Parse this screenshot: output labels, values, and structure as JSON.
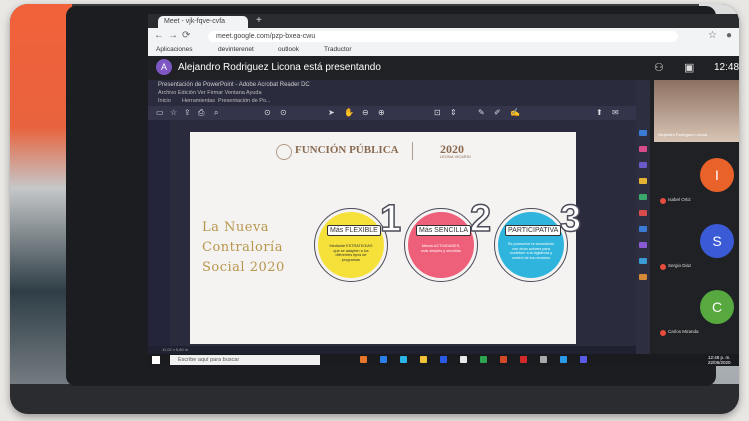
{
  "browser": {
    "tab_label": "Meet - vjk-fqve-cvfa",
    "url": "meet.google.com/pzp-bxea-cwu",
    "bookmarks": [
      "Aplicaciones",
      "devinterenet",
      "outlook",
      "Traductor"
    ]
  },
  "meet": {
    "avatar_letter": "A",
    "presenting_text": "Alejandro Rodriguez Licona está presentando",
    "time": "12:48"
  },
  "app": {
    "title": "Presentación de PowerPoint - Adobe Acrobat Reader DC",
    "menu": "Archivo  Edición  Ver  Firmar  Ventana  Ayuda",
    "tabs": [
      "Inicio",
      "Herramientas",
      "Presentación de Po..."
    ],
    "status": "11,02 x 5,80 in"
  },
  "slide": {
    "logo_left": "FUNCIÓN PÚBLICA",
    "logo_right": "2020",
    "logo_right_sub": "LEONA VICARIO",
    "title_lines": [
      "La Nueva",
      "Contraloría",
      "Social 2020"
    ],
    "items": [
      {
        "number": "1",
        "label": "Más FLEXIBLE",
        "text": "Mediante ESTRATEGIAS que se adapten a los diferentes tipos de programas"
      },
      {
        "number": "2",
        "label": "Más SENCILLA",
        "text": "Menos ACTIVIDADES, más simples y sencillas"
      },
      {
        "number": "3",
        "label": "PARTICIPATIVA",
        "text": "Se promueve la vinculación con otros actores para contribuir a la vigilancia y control de los recursos"
      }
    ],
    "colors": {
      "circle1": "#f5e13a",
      "circle2": "#ee5f7a",
      "circle3": "#2fb4dd",
      "title": "#b8964e"
    }
  },
  "participants": {
    "presenter_name": "Alejandro Rodriguez Licona",
    "people": [
      {
        "initial": "I",
        "name": "Isabel Ortiz",
        "color": "#e8622a"
      },
      {
        "initial": "S",
        "name": "Sergio Diaz",
        "color": "#3b5bd6"
      },
      {
        "initial": "C",
        "name": "Carlos Miranda",
        "color": "#56a83f"
      }
    ]
  },
  "taskbar": {
    "search_placeholder": "Escribe aquí para buscar",
    "tray_time": "12:48 p. m.",
    "tray_date": "22/06/2020"
  }
}
